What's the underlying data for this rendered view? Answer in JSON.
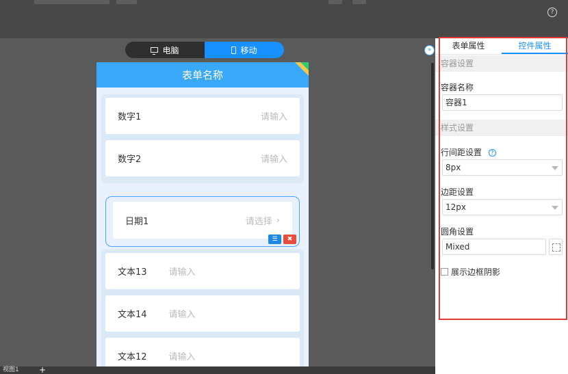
{
  "toolbar": {
    "help_icon": "?"
  },
  "device_switch": {
    "desktop_label": "电脑",
    "mobile_label": "移动"
  },
  "form": {
    "title": "表单名称",
    "fields": [
      {
        "label": "数字1",
        "placeholder": "请输入"
      },
      {
        "label": "数字2",
        "placeholder": "请输入"
      },
      {
        "label": "日期1",
        "placeholder": "请选择"
      },
      {
        "label": "文本13",
        "placeholder": "请输入"
      },
      {
        "label": "文本14",
        "placeholder": "请输入"
      },
      {
        "label": "文本12",
        "placeholder": "请输入"
      }
    ]
  },
  "bottom": {
    "view_tab": "视图1",
    "add_label": "+"
  },
  "panel": {
    "collapse_icon": "»",
    "tabs": [
      "表单属性",
      "控件属性"
    ],
    "active_tab": "控件属性",
    "container_section": "容器设置",
    "container_name_label": "容器名称",
    "container_name_value": "容器1",
    "style_section": "样式设置",
    "line_spacing_label": "行间距设置",
    "line_spacing_value": "8px",
    "margin_label": "边距设置",
    "margin_value": "12px",
    "radius_label": "圆角设置",
    "radius_value": "Mixed",
    "shadow_label": "展示边框阴影",
    "shadow_checked": false
  },
  "colors": {
    "accent": "#1890ff",
    "header": "#3aa8f8",
    "highlight": "#e53935"
  },
  "icons": [
    "help-icon",
    "monitor-icon",
    "phone-icon",
    "list-icon",
    "delete-icon",
    "chevron-right-icon",
    "question-icon",
    "dropdown-arrow-icon",
    "expand-icon",
    "collapse-icon"
  ]
}
